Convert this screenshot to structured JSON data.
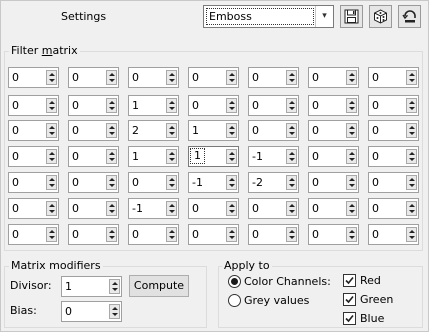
{
  "header": {
    "settings_label": "Settings",
    "preset_value": "Emboss",
    "dropdown_arrow": "▾"
  },
  "filter_matrix": {
    "title_prefix": "Filter ",
    "title_underlined": "m",
    "title_suffix": "atrix",
    "rows": [
      [
        "0",
        "0",
        "0",
        "0",
        "0",
        "0",
        "0"
      ],
      [
        "0",
        "0",
        "1",
        "0",
        "0",
        "0",
        "0"
      ],
      [
        "0",
        "0",
        "2",
        "1",
        "0",
        "0",
        "0"
      ],
      [
        "0",
        "0",
        "1",
        "1",
        "-1",
        "0",
        "0"
      ],
      [
        "0",
        "0",
        "0",
        "-1",
        "-2",
        "0",
        "0"
      ],
      [
        "0",
        "0",
        "-1",
        "0",
        "0",
        "0",
        "0"
      ],
      [
        "0",
        "0",
        "0",
        "0",
        "0",
        "0",
        "0"
      ]
    ]
  },
  "matrix_modifiers": {
    "title": "Matrix modifiers",
    "divisor_label": "Divisor:",
    "divisor_value": "1",
    "bias_label": "Bias:",
    "bias_value": "0",
    "compute_label": "Compute"
  },
  "apply_to": {
    "title": "Apply to",
    "color_channels_label": "Color Channels:",
    "grey_values_label": "Grey values",
    "selected": "color_channels",
    "channels": [
      {
        "label": "Red",
        "checked": true
      },
      {
        "label": "Green",
        "checked": true
      },
      {
        "label": "Blue",
        "checked": true
      }
    ]
  }
}
